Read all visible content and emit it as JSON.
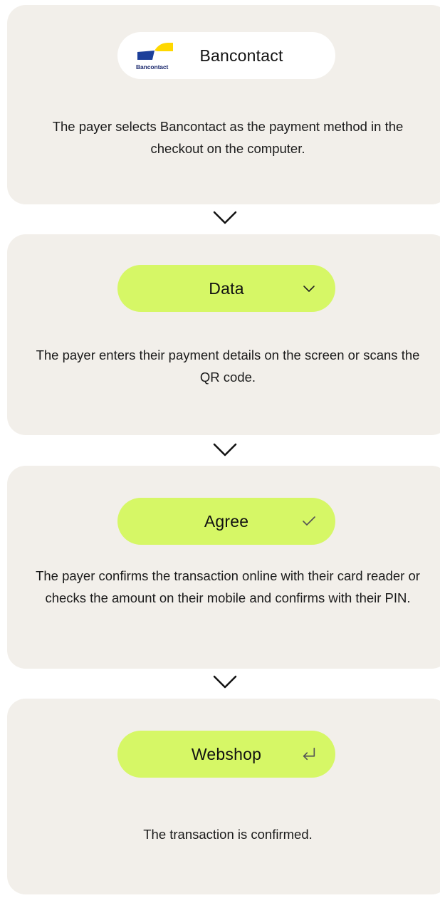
{
  "steps": [
    {
      "label": "Bancontact",
      "logo_text": "Bancontact",
      "icon": "bancontact-logo",
      "description": "The payer selects Bancontact as the payment method in the checkout on the computer."
    },
    {
      "label": "Data",
      "icon": "chevron-down-icon",
      "description": "The payer enters their payment details on the screen or scans the QR code."
    },
    {
      "label": "Agree",
      "icon": "check-icon",
      "description": "The payer confirms the transaction online with their card reader or checks the amount on their mobile and confirms with their PIN."
    },
    {
      "label": "Webshop",
      "icon": "return-arrow-icon",
      "description": "The transaction is confirmed."
    }
  ],
  "colors": {
    "card_background": "#f2efea",
    "pill_accent": "#d6f766",
    "pill_white": "#ffffff",
    "logo_blue": "#1c2a6e",
    "logo_yellow": "#ffd800"
  }
}
